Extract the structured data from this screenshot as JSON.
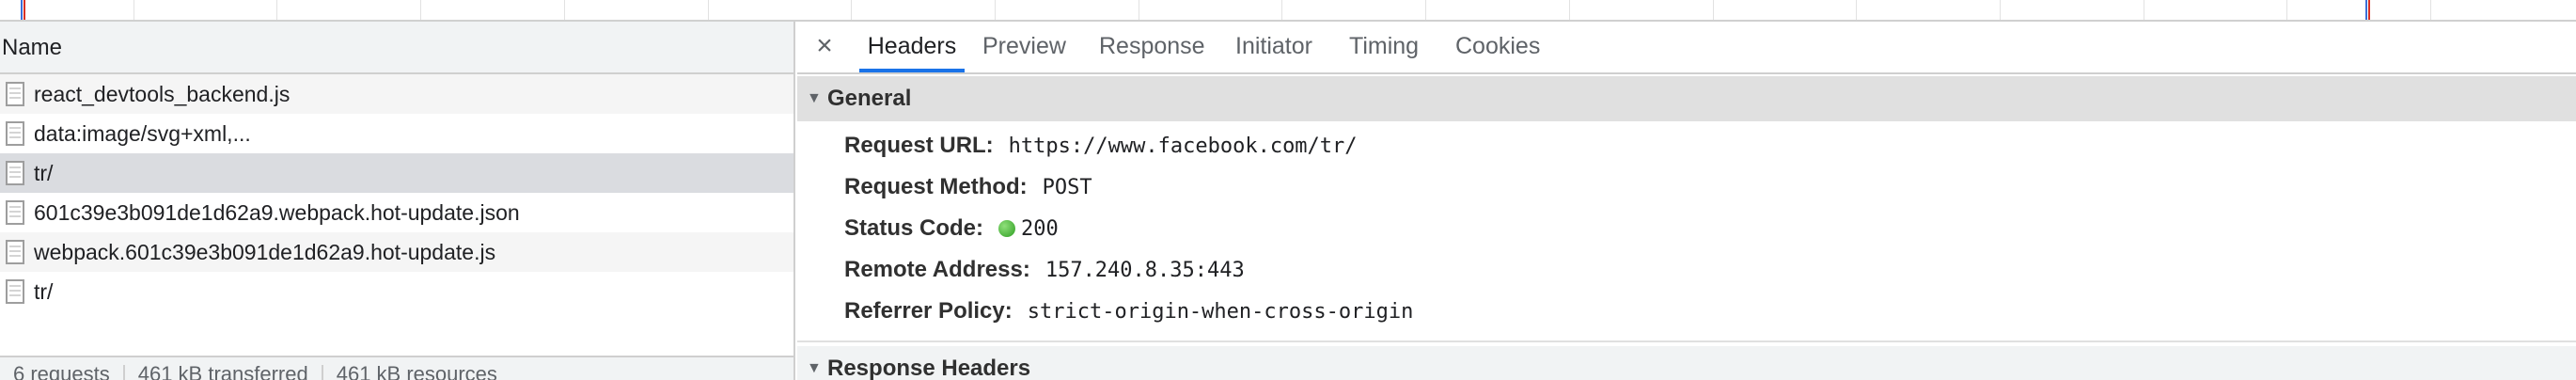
{
  "request_list": {
    "column_header": "Name",
    "rows": [
      {
        "name": "react_devtools_backend.js"
      },
      {
        "name": "data:image/svg+xml,..."
      },
      {
        "name": "tr/"
      },
      {
        "name": "601c39e3b091de1d62a9.webpack.hot-update.json"
      },
      {
        "name": "webpack.601c39e3b091de1d62a9.hot-update.js"
      },
      {
        "name": "tr/"
      }
    ],
    "selected_index": 2,
    "status": {
      "requests": "6 requests",
      "transferred": "461 kB transferred",
      "resources": "461 kB resources"
    }
  },
  "details": {
    "close_symbol": "×",
    "tabs": [
      "Headers",
      "Preview",
      "Response",
      "Initiator",
      "Timing",
      "Cookies"
    ],
    "active_tab": "Headers",
    "general": {
      "title": "General",
      "request_url_label": "Request URL:",
      "request_url": "https://www.facebook.com/tr/",
      "request_method_label": "Request Method:",
      "request_method": "POST",
      "status_code_label": "Status Code:",
      "status_code": "200",
      "remote_address_label": "Remote Address:",
      "remote_address": "157.240.8.35:443",
      "referrer_policy_label": "Referrer Policy:",
      "referrer_policy": "strict-origin-when-cross-origin"
    },
    "response_headers": {
      "title": "Response Headers"
    }
  },
  "colors": {
    "accent": "#1a73e8",
    "status_ok": "#2e9d22",
    "selected_row": "#dadce0",
    "section_header": "#e0e0e0"
  }
}
